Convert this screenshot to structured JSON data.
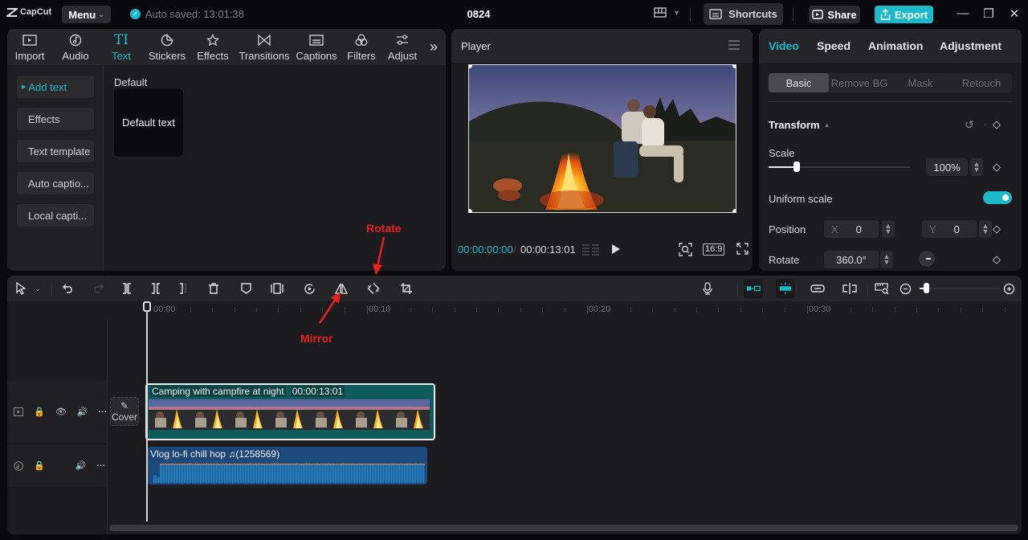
{
  "titlebar": {
    "logo": "CapCut",
    "menu_label": "Menu",
    "autosave": "Auto saved: 13:01:38",
    "project_name": "0824",
    "shortcuts_label": "Shortcuts",
    "share_label": "Share",
    "export_label": "Export"
  },
  "media": {
    "tabs": [
      {
        "label": "Import",
        "icon": "import-icon"
      },
      {
        "label": "Audio",
        "icon": "audio-icon"
      },
      {
        "label": "Text",
        "icon": "text-icon",
        "active": true
      },
      {
        "label": "Stickers",
        "icon": "stickers-icon"
      },
      {
        "label": "Effects",
        "icon": "effects-icon"
      },
      {
        "label": "Transitions",
        "icon": "transitions-icon"
      },
      {
        "label": "Captions",
        "icon": "captions-icon"
      },
      {
        "label": "Filters",
        "icon": "filters-icon"
      },
      {
        "label": "Adjust",
        "icon": "adjust-icon"
      }
    ],
    "sidebar": [
      {
        "label": "Add text",
        "active": true
      },
      {
        "label": "Effects"
      },
      {
        "label": "Text template"
      },
      {
        "label": "Auto captio..."
      },
      {
        "label": "Local capti..."
      }
    ],
    "section_label": "Default",
    "card_label": "Default text"
  },
  "player": {
    "title": "Player",
    "current_time": "00:00:00:00",
    "duration": "00:00:13:01",
    "aspect_ratio": "16:9"
  },
  "properties": {
    "tabs": [
      "Video",
      "Speed",
      "Animation",
      "Adjustment"
    ],
    "active_tab": "Video",
    "subtabs": [
      "Basic",
      "Remove BG",
      "Mask",
      "Retouch"
    ],
    "active_subtab": "Basic",
    "transform_label": "Transform",
    "scale_label": "Scale",
    "scale_value": "100%",
    "scale_slider_fraction": 0.2,
    "uniform_scale_label": "Uniform scale",
    "uniform_scale_on": true,
    "position_label": "Position",
    "position_x_label": "X",
    "position_x": "0",
    "position_y_label": "Y",
    "position_y": "0",
    "rotate_label": "Rotate",
    "rotate_value": "360.0°"
  },
  "timeline": {
    "ruler": [
      "00:00",
      "00:10",
      "00:20",
      "00:30"
    ],
    "cover_label": "Cover",
    "video_clip": {
      "title": "Camping with campfire at night",
      "duration": "00:00:13:01"
    },
    "audio_clip": {
      "title": "Vlog  lo-fi chill hop ♫(1258569)"
    },
    "zoom_fraction": 0.08
  },
  "annotations": {
    "rotate": "Rotate",
    "mirror": "Mirror"
  },
  "colors": {
    "accent": "#1bb9c9",
    "annotation": "#e8201c",
    "video_clip": "#0e5a5a",
    "audio_clip": "#1a4b7c"
  }
}
